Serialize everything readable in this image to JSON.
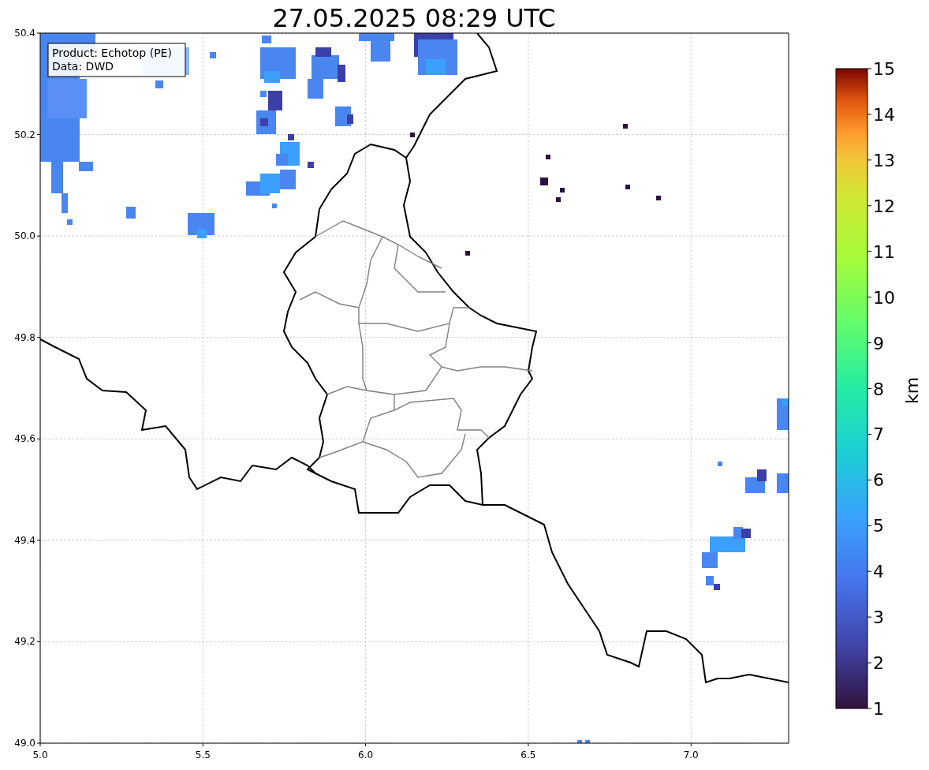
{
  "title": "27.05.2025 08:29 UTC",
  "legend": {
    "lines": [
      "Product: Echotop (PE)",
      "Data: DWD"
    ]
  },
  "map": {
    "x_ticks": [
      "5.0",
      "5.5",
      "6.0",
      "6.5",
      "7.0"
    ],
    "y_ticks": [
      "50.4",
      "50.2",
      "50.0",
      "49.8",
      "49.6",
      "49.4",
      "49.2",
      "49.0"
    ]
  },
  "colorbar": {
    "label": "km",
    "ticks": [
      "15",
      "14",
      "13",
      "12",
      "11",
      "10",
      "9",
      "8",
      "7",
      "6",
      "5",
      "4",
      "3",
      "2",
      "1"
    ]
  }
}
